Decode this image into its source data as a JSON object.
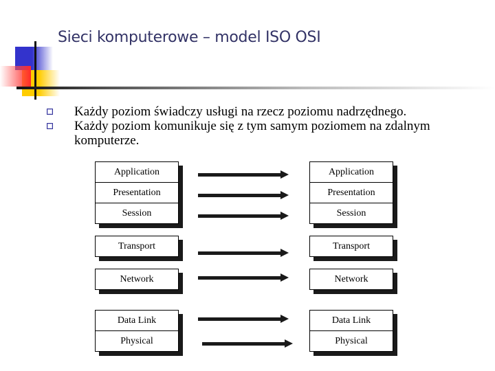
{
  "slide": {
    "title": "Sieci komputerowe – model ISO OSI",
    "bullets": [
      "Każdy poziom świadczy usługi na rzecz poziomu nadrzędnego.",
      "Każdy poziom komunikuje się z tym samym poziomem na zdalnym komputerze."
    ],
    "bullet_icon": "hollow-square-icon"
  },
  "diagram": {
    "left_stack": {
      "upper_group": [
        "Application",
        "Presentation",
        "Session"
      ],
      "transport": "Transport",
      "network": "Network",
      "lower_group": [
        "Data Link",
        "Physical"
      ]
    },
    "right_stack": {
      "upper_group": [
        "Application",
        "Presentation",
        "Session"
      ],
      "transport": "Transport",
      "network": "Network",
      "lower_group": [
        "Data Link",
        "Physical"
      ]
    },
    "arrow_direction": "left-to-right",
    "colors": {
      "title": "#333366",
      "accent_blue": "#3333cc",
      "accent_yellow": "#ffcc00",
      "accent_red": "#ff2a2a",
      "shadow": "#1a1a1a"
    }
  }
}
